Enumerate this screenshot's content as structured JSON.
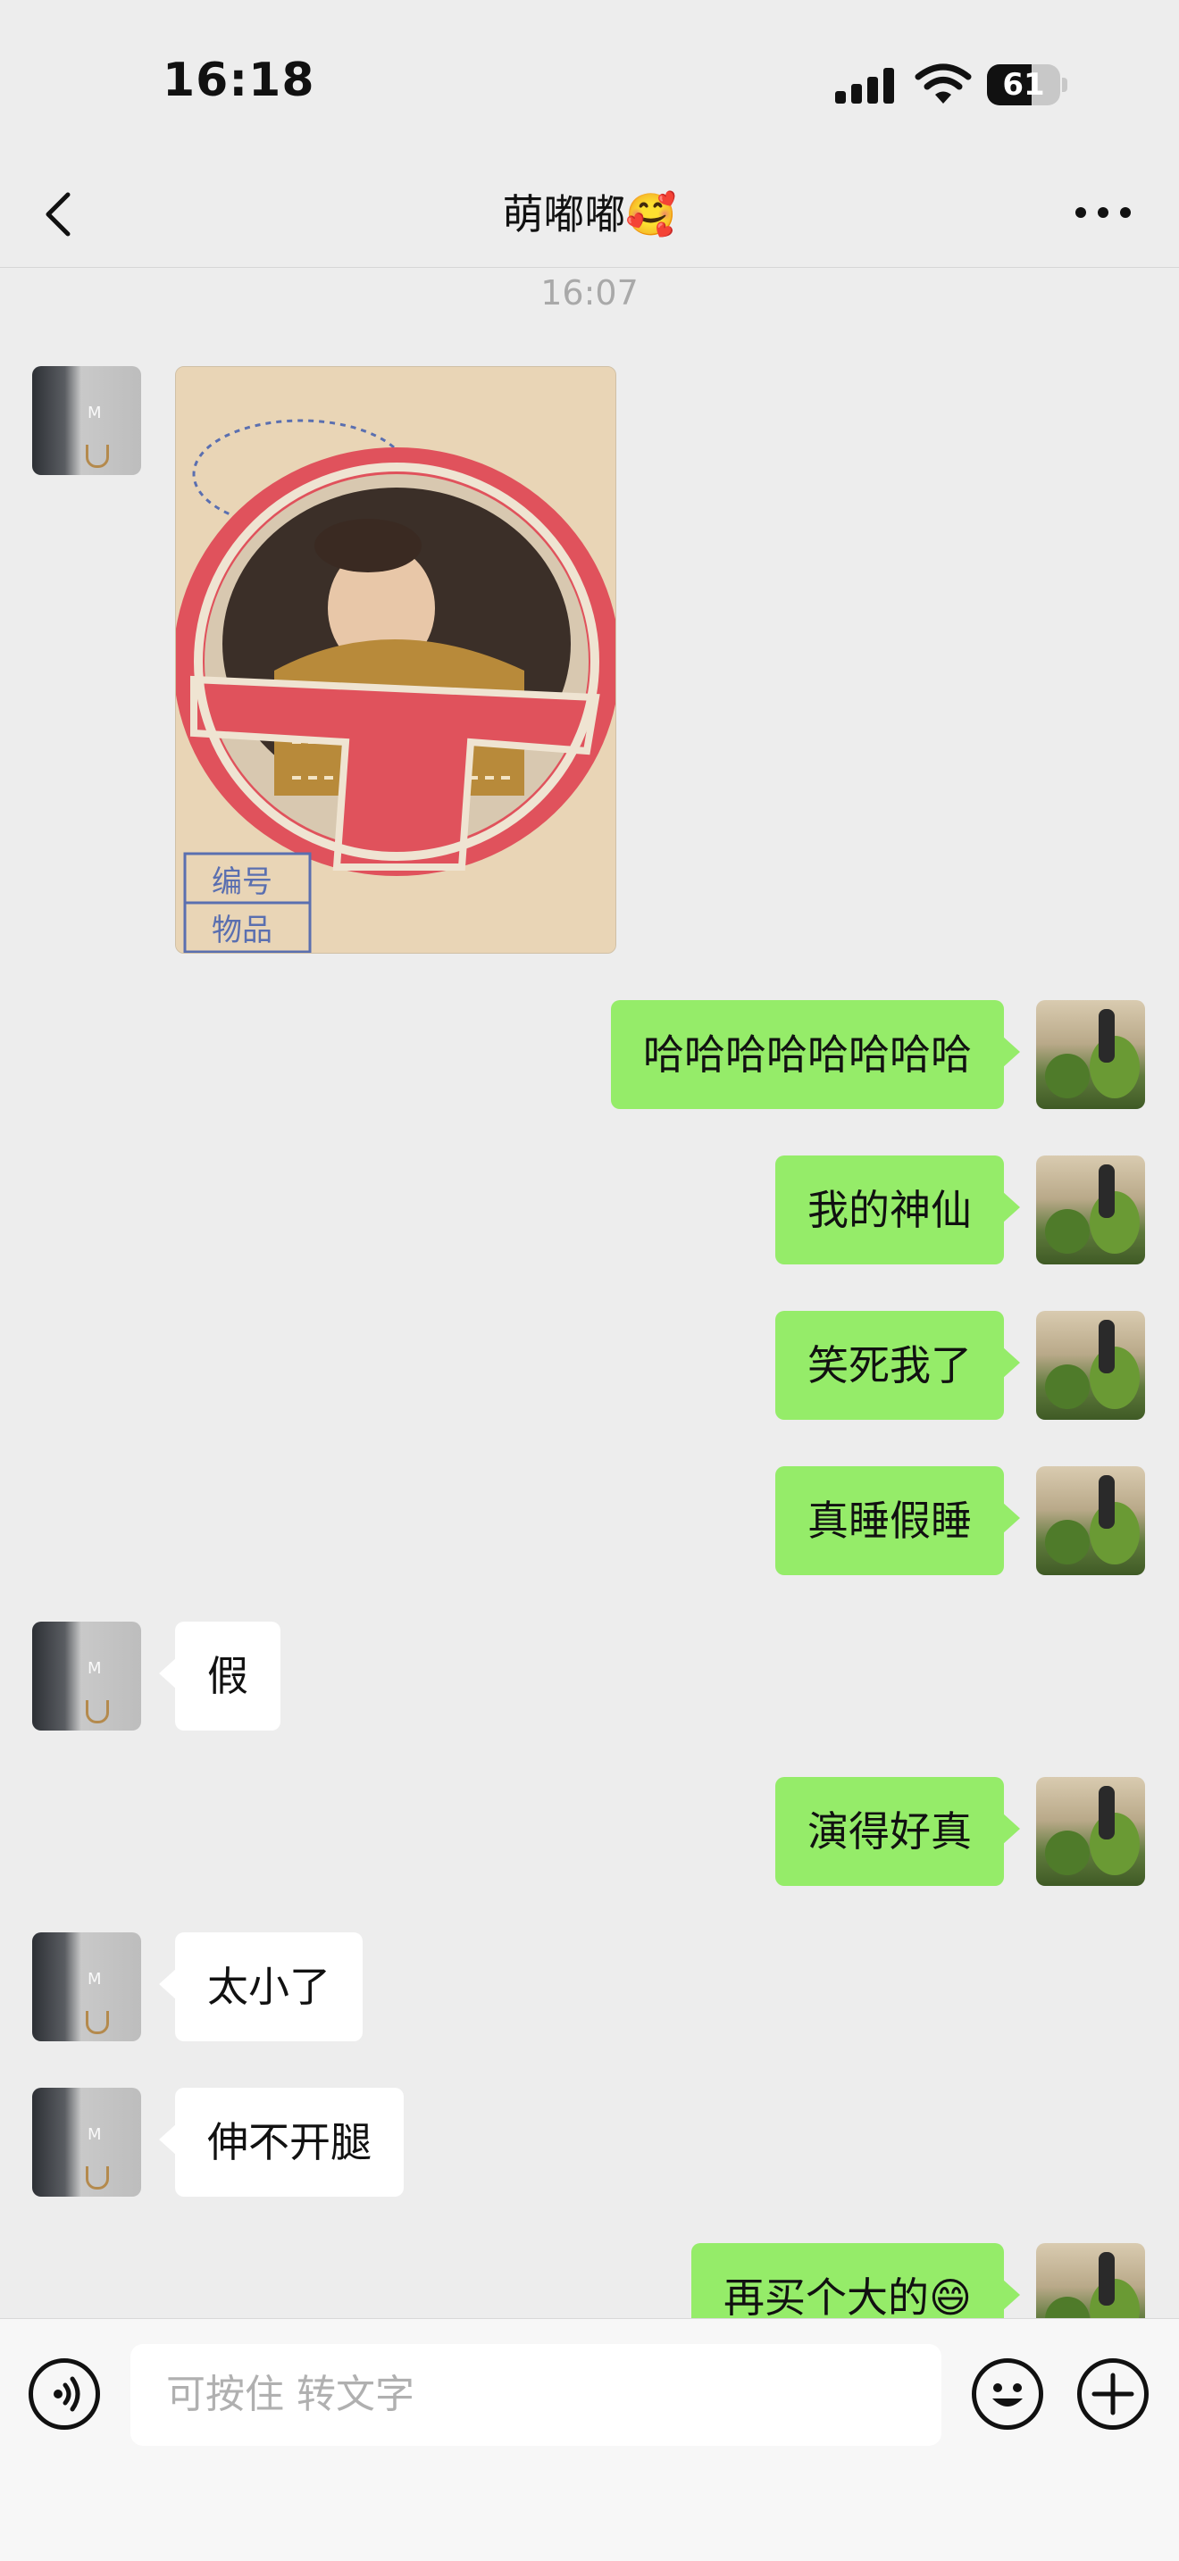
{
  "status_bar": {
    "time": "16:18",
    "battery_level": "61",
    "signal_icon": "cellular-signal-icon",
    "wifi_icon": "wifi-icon"
  },
  "header": {
    "title": "萌嘟嘟🥰",
    "back_icon": "chevron-left-icon",
    "more_icon": "more-dots-icon"
  },
  "chat": {
    "timestamp": "16:07",
    "messages": [
      {
        "sender": "other",
        "type": "image"
      },
      {
        "sender": "self",
        "text": "哈哈哈哈哈哈哈哈"
      },
      {
        "sender": "self",
        "text": "我的神仙"
      },
      {
        "sender": "self",
        "text": "笑死我了"
      },
      {
        "sender": "self",
        "text": "真睡假睡"
      },
      {
        "sender": "other",
        "text": "假"
      },
      {
        "sender": "self",
        "text": "演得好真"
      },
      {
        "sender": "other",
        "text": "太小了"
      },
      {
        "sender": "other",
        "text": "伸不开腿"
      },
      {
        "sender": "self",
        "text": "再买个大的😄"
      }
    ],
    "photo_text": [
      "编号",
      "物品"
    ]
  },
  "input_bar": {
    "placeholder": "可按住 转文字",
    "voice_icon": "voice-input-icon",
    "emoji_icon": "emoji-icon",
    "plus_icon": "plus-icon"
  },
  "colors": {
    "background": "#ededed",
    "self_bubble": "#95ec69",
    "other_bubble": "#ffffff",
    "timestamp": "#a9a9a9"
  }
}
